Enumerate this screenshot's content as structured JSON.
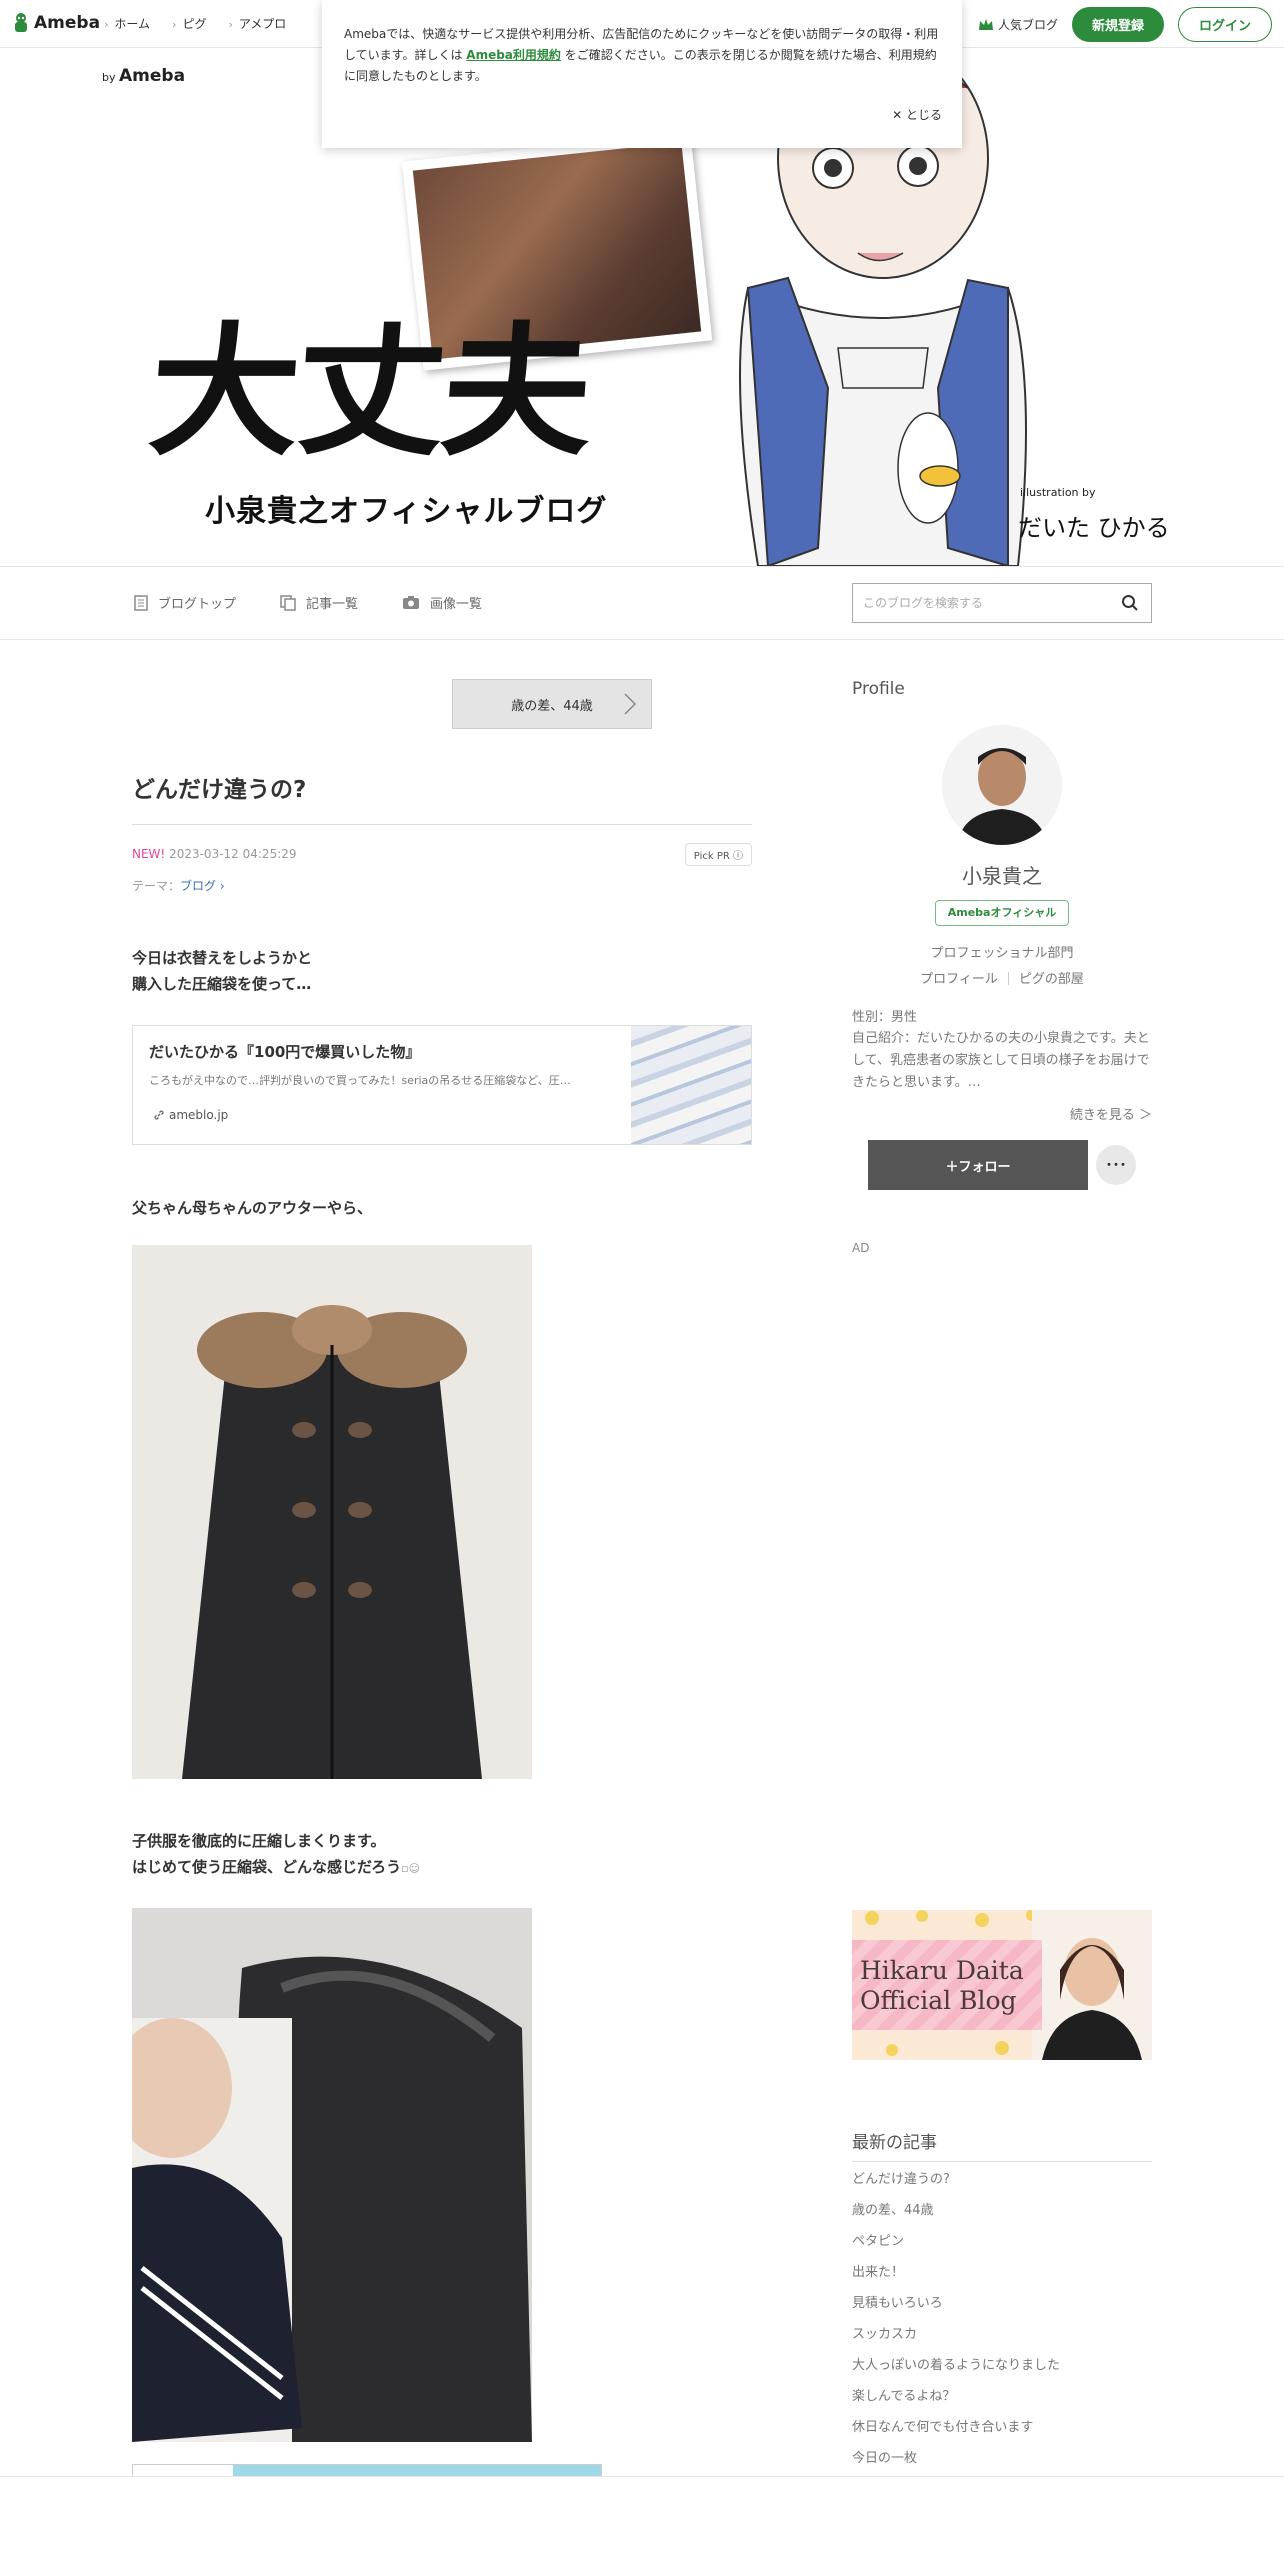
{
  "header": {
    "logo": "Ameba",
    "nav": [
      "ホーム",
      "ピグ",
      "アメプロ"
    ],
    "popular": "人気ブログ",
    "signup": "新規登録",
    "login": "ログイン"
  },
  "cookie": {
    "text_before": "Amebaでは、快適なサービス提供や利用分析、広告配信のためにクッキーなどを使い訪問データの取得・利用しています。詳しくは",
    "link": "Ameba利用規約",
    "text_after": "をご確認ください。この表示を閉じるか閲覧を続けた場合、利用規約に同意したものとします。",
    "close": "とじる"
  },
  "hero": {
    "by": "by",
    "by_brand": "Ameba",
    "title_kanji": "大丈夫",
    "subtitle": "小泉貴之オフィシャルブログ",
    "illustration_by": "illustration by",
    "signature": "だいた ひかる"
  },
  "blognav": {
    "items": [
      "ブログトップ",
      "記事一覧",
      "画像一覧"
    ],
    "search_placeholder": "このブログを検索する"
  },
  "article": {
    "prev": "歳の差、44歳",
    "title": "どんだけ違うの?",
    "new": "NEW!",
    "date": "2023-03-12 04:25:29",
    "pickpr": "Pick PR",
    "theme_label": "テーマ：",
    "theme": "ブログ",
    "p1": "今日は衣替えをしようかと",
    "p1b": "購入した圧縮袋を使って…",
    "card_title": "だいたひかる『100円で爆買いした物』",
    "card_desc": "ころもがえ中なので…評判が良いので買ってみた！seriaの吊るせる圧縮袋など、圧…",
    "card_url": "ameblo.jp",
    "p2": "父ちゃん母ちゃんのアウターやら、",
    "p3": "子供服を徹底的に圧縮しまくります。",
    "p3b": "はじめて使う圧縮袋、どんな感じだろう"
  },
  "profile": {
    "title": "Profile",
    "name": "小泉貴之",
    "badge": "Amebaオフィシャル",
    "dept": "プロフェッショナル部門",
    "link1": "プロフィール",
    "link2": "ピグの部屋",
    "sex": "性別：男性",
    "intro": "自己紹介：だいたひかるの夫の小泉貴之です。夫として、乳癌患者の家族として日頃の様子をお届けできたらと思います。…",
    "more": "続きを見る ＞",
    "follow": "＋フォロー",
    "dots": "･･･",
    "ad": "AD"
  },
  "sidebanner": {
    "line1": "Hikaru Daita",
    "line2": "Official Blog"
  },
  "recent": {
    "title": "最新の記事",
    "items": [
      "どんだけ違うの?",
      "歳の差、44歳",
      "ペタピン",
      "出来た！",
      "見積もいろいろ",
      "スッカスカ",
      "大人っぽいの着るようになりました",
      "楽しんでるよね？",
      "休日なんで何でも付き合います",
      "今日の一枚"
    ]
  }
}
